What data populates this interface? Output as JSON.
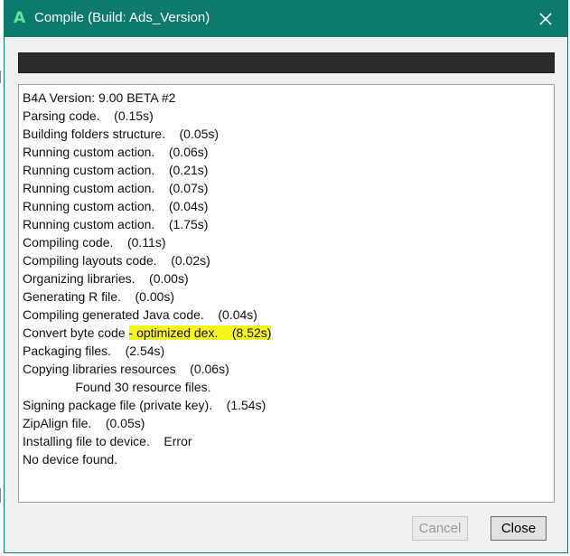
{
  "window": {
    "title": "Compile (Build: Ads_Version)",
    "app_icon_letter": "A",
    "title_bar_color": "#0e7a6e"
  },
  "log": {
    "lines": [
      {
        "text": "B4A Version: 9.00 BETA #2"
      },
      {
        "text": "Parsing code.    (0.15s)"
      },
      {
        "text": "Building folders structure.    (0.05s)"
      },
      {
        "text": "Running custom action.    (0.06s)"
      },
      {
        "text": "Running custom action.    (0.21s)"
      },
      {
        "text": "Running custom action.    (0.07s)"
      },
      {
        "text": "Running custom action.    (0.04s)"
      },
      {
        "text": "Running custom action.    (1.75s)"
      },
      {
        "text": "Compiling code.    (0.11s)"
      },
      {
        "text": "Compiling layouts code.    (0.02s)"
      },
      {
        "text": "Organizing libraries.    (0.00s)"
      },
      {
        "text": "Generating R file.    (0.00s)"
      },
      {
        "text": "Compiling generated Java code.    (0.04s)"
      },
      {
        "text": "Convert byte code ",
        "highlight": "- optimized dex.    (8.52s)"
      },
      {
        "text": "Packaging files.    (2.54s)"
      },
      {
        "text": "Copying libraries resources    (0.06s)"
      },
      {
        "text": "               Found 30 resource files."
      },
      {
        "text": "Signing package file (private key).    (1.54s)"
      },
      {
        "text": "ZipAlign file.    (0.05s)"
      },
      {
        "text": "Installing file to device.    Error"
      },
      {
        "text": "No device found."
      }
    ],
    "highlight_color": "#f5f51e"
  },
  "buttons": {
    "cancel_label": "Cancel",
    "close_label": "Close"
  },
  "icons": {
    "close": "close-icon",
    "app": "b4a-app-icon"
  }
}
